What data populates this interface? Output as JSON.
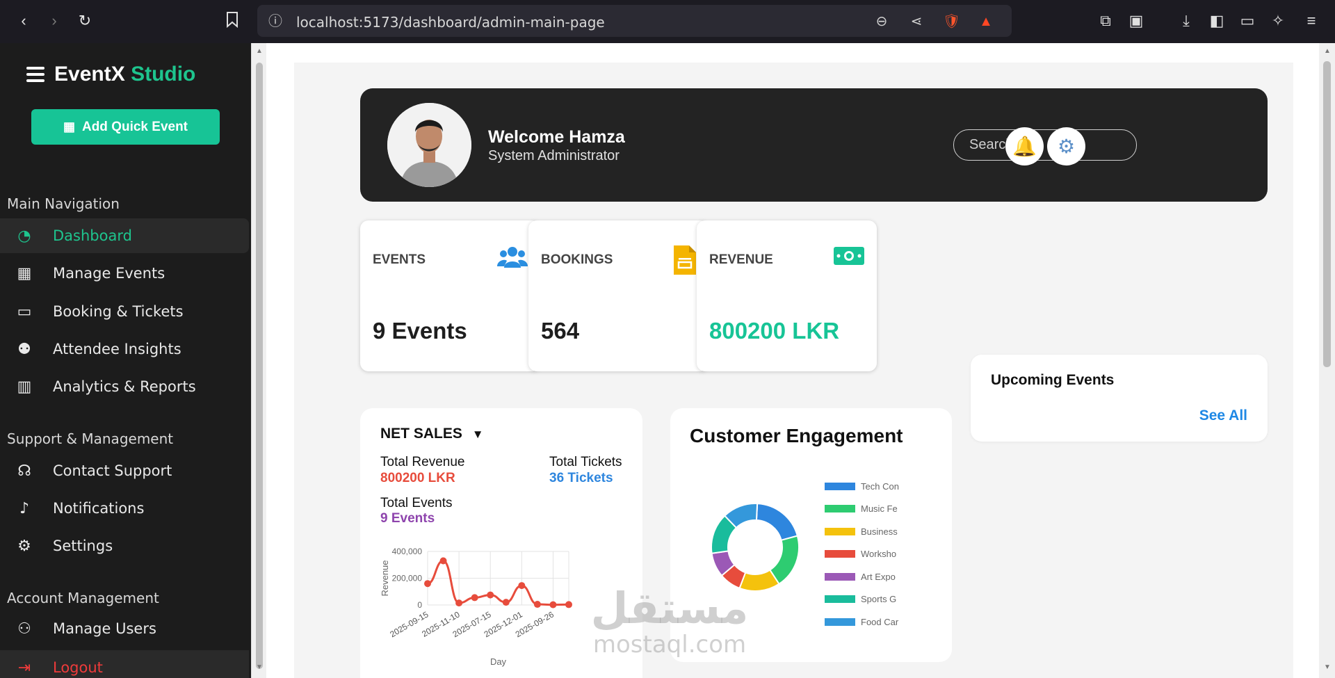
{
  "browser": {
    "url": "localhost:5173/dashboard/admin-main-page"
  },
  "sidebar": {
    "brand_main": "EventX",
    "brand_accent": "Studio",
    "quick_button": "Add Quick Event",
    "sections": [
      {
        "title": "Main Navigation",
        "items": [
          {
            "label": "Dashboard",
            "icon": "gauge-icon",
            "active": true
          },
          {
            "label": "Manage Events",
            "icon": "calendar-icon"
          },
          {
            "label": "Booking & Tickets",
            "icon": "ticket-icon"
          },
          {
            "label": "Attendee Insights",
            "icon": "users-icon"
          },
          {
            "label": "Analytics & Reports",
            "icon": "bar-chart-icon"
          }
        ]
      },
      {
        "title": "Support & Management",
        "items": [
          {
            "label": "Contact Support",
            "icon": "headset-icon"
          },
          {
            "label": "Notifications",
            "icon": "bell-icon"
          },
          {
            "label": "Settings",
            "icon": "gear-icon"
          }
        ]
      },
      {
        "title": "Account Management",
        "items": [
          {
            "label": "Manage Users",
            "icon": "user-gear-icon"
          },
          {
            "label": "Logout",
            "icon": "logout-icon"
          }
        ]
      }
    ]
  },
  "header": {
    "welcome": "Welcome Hamza",
    "role": "System Administrator",
    "search_placeholder": "Search ..."
  },
  "stats": [
    {
      "label": "EVENTS",
      "value": "9 Events",
      "icon": "users-icon",
      "color": "#2a8ee0"
    },
    {
      "label": "BOOKINGS",
      "value": "564",
      "icon": "document-icon",
      "color": "#f4b400"
    },
    {
      "label": "REVENUE",
      "value": "800200 LKR",
      "icon": "money-icon",
      "color": "#17c496"
    }
  ],
  "upcoming": {
    "title": "Upcoming Events",
    "see_all": "See All"
  },
  "net_sales": {
    "title": "NET SALES",
    "caret": "▼",
    "total_revenue_label": "Total Revenue",
    "total_revenue_value": "800200 LKR",
    "total_tickets_label": "Total Tickets",
    "total_tickets_value": "36 Tickets",
    "total_events_label": "Total Events",
    "total_events_value": "9 Events",
    "colors": {
      "revenue": "#e74c3c",
      "tickets": "#2e86de",
      "events": "#8e44ad"
    }
  },
  "engagement": {
    "title": "Customer Engagement",
    "legend": [
      "Tech Con",
      "Music Fe",
      "Business",
      "Worksho",
      "Art Expo",
      "Sports G",
      "Food Car"
    ]
  },
  "watermark": {
    "top": "مستقل",
    "bottom": "mostaql.com"
  },
  "chart_data": [
    {
      "type": "line",
      "title": "",
      "xlabel": "Day",
      "ylabel": "Revenue",
      "x": [
        "2025-09-15",
        "2025-10-01",
        "2025-11-10",
        "2025-10-20",
        "2025-07-15",
        "2025-08-01",
        "2025-12-01",
        "2025-09-01",
        "2025-09-26",
        "2025-10-10"
      ],
      "x_tick_labels": [
        "2025-09-15",
        "2025-11-10",
        "2025-07-15",
        "2025-12-01",
        "2025-09-26"
      ],
      "values": [
        160000,
        330000,
        15000,
        55000,
        75000,
        20000,
        145000,
        5000,
        2000,
        3000
      ],
      "ylim": [
        0,
        400000
      ],
      "y_ticks": [
        "400,000",
        "200,000",
        "0"
      ],
      "color": "#e74c3c",
      "grid": true
    },
    {
      "type": "pie",
      "title": "",
      "labels": [
        "Tech Con",
        "Music Fe",
        "Business",
        "Worksho",
        "Art Expo",
        "Sports G",
        "Food Car"
      ],
      "values": [
        20,
        20,
        15,
        8,
        9,
        15,
        13
      ],
      "colors": [
        "#2e86de",
        "#2ecc71",
        "#f4c20d",
        "#e74c3c",
        "#9b59b6",
        "#1abc9c",
        "#3498db"
      ],
      "legend": "right"
    }
  ]
}
